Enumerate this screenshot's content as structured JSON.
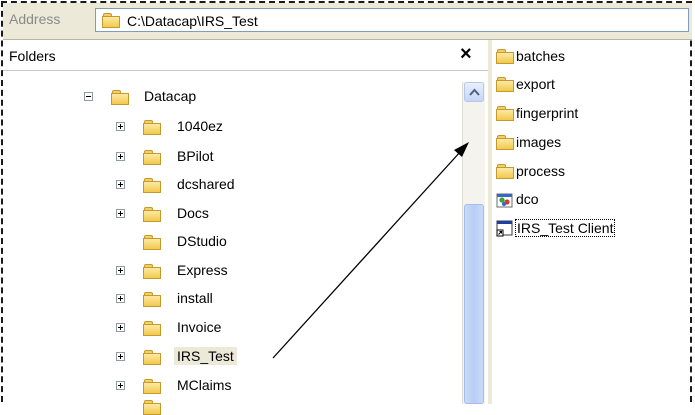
{
  "address": {
    "label": "Address",
    "path": "C:\\Datacap\\IRS_Test"
  },
  "folders_pane": {
    "title": "Folders",
    "close_glyph": "×",
    "tree": [
      {
        "label": "Datacap",
        "expander": "minus"
      },
      {
        "label": "1040ez",
        "expander": "plus"
      },
      {
        "label": "BPilot",
        "expander": "plus"
      },
      {
        "label": "dcshared",
        "expander": "plus"
      },
      {
        "label": "Docs",
        "expander": "plus"
      },
      {
        "label": "DStudio",
        "expander": "none"
      },
      {
        "label": "Express",
        "expander": "plus"
      },
      {
        "label": "install",
        "expander": "plus"
      },
      {
        "label": "Invoice",
        "expander": "plus"
      },
      {
        "label": "IRS_Test",
        "expander": "plus",
        "selected": true
      },
      {
        "label": "MClaims",
        "expander": "plus"
      }
    ]
  },
  "contents_pane": {
    "items": [
      {
        "label": "batches",
        "icon": "folder-icon"
      },
      {
        "label": "export",
        "icon": "folder-icon"
      },
      {
        "label": "fingerprint",
        "icon": "folder-icon"
      },
      {
        "label": "images",
        "icon": "folder-icon"
      },
      {
        "label": "process",
        "icon": "folder-icon"
      },
      {
        "label": "dco",
        "icon": "dco-file-icon"
      },
      {
        "label": "IRS_Test Client",
        "icon": "app-shortcut-icon",
        "focused": true
      }
    ]
  },
  "colors": {
    "selection": "#ece9d8",
    "folder": "#f2c94d",
    "scrollbar": "#c5d6f6",
    "arrow": "#000000"
  }
}
